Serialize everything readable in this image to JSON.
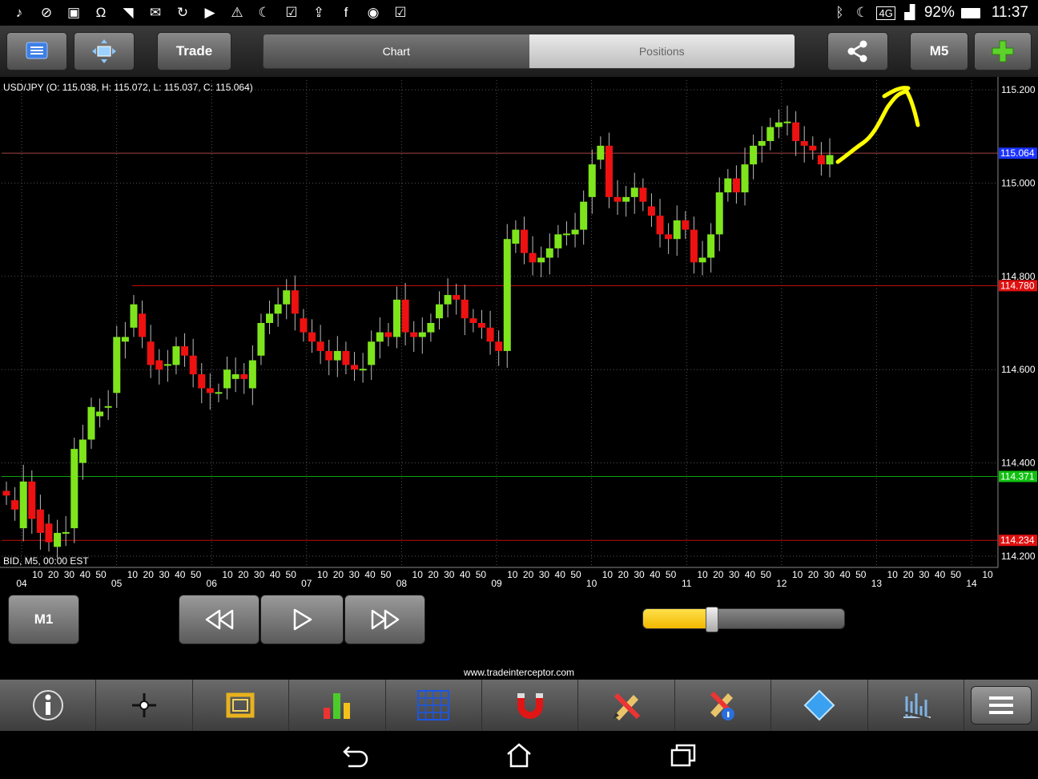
{
  "status": {
    "battery": "92%",
    "time": "11:37",
    "network": "4G"
  },
  "toolbar": {
    "trade_label": "Trade",
    "tabs": [
      "Chart",
      "Positions"
    ],
    "active_tab": "Chart",
    "timeframe_label": "M5"
  },
  "chart": {
    "header": "USD/JPY (O: 115.038, H: 115.072, L: 115.037, C: 115.064)",
    "footer": "BID, M5, 00:00 EST",
    "price_labels": [
      "115.200",
      "115.000",
      "114.800",
      "114.600",
      "114.400",
      "114.200"
    ],
    "markers": [
      {
        "label": "115.064",
        "color": "#1a33ff"
      },
      {
        "label": "114.780",
        "color": "#e01010"
      },
      {
        "label": "114.371",
        "color": "#10c010"
      },
      {
        "label": "114.234",
        "color": "#e01010"
      }
    ],
    "day_labels": [
      "04",
      "05",
      "06",
      "07",
      "08",
      "09",
      "10",
      "11",
      "12",
      "13",
      "14"
    ],
    "minute_labels": [
      "10",
      "20",
      "30",
      "40",
      "50"
    ],
    "colors": {
      "bull": "#7ee51c",
      "bear": "#ee1111",
      "annotation": "#ffff00"
    }
  },
  "chart_data": {
    "type": "candlestick",
    "symbol": "USD/JPY",
    "timeframe": "M5",
    "ylim": [
      114.18,
      115.22
    ],
    "current": {
      "open": 115.038,
      "high": 115.072,
      "low": 115.037,
      "close": 115.064
    },
    "horizontal_lines": [
      115.064,
      114.78,
      114.371,
      114.234
    ],
    "candles": [
      [
        114.34,
        114.33
      ],
      [
        114.32,
        114.3
      ],
      [
        114.26,
        114.36
      ],
      [
        114.36,
        114.28
      ],
      [
        114.3,
        114.25
      ],
      [
        114.27,
        114.23
      ],
      [
        114.22,
        114.25
      ],
      [
        114.25,
        114.25
      ],
      [
        114.26,
        114.43
      ],
      [
        114.4,
        114.45
      ],
      [
        114.45,
        114.52
      ],
      [
        114.5,
        114.51
      ],
      [
        114.52,
        114.52
      ],
      [
        114.55,
        114.67
      ],
      [
        114.66,
        114.67
      ],
      [
        114.69,
        114.74
      ],
      [
        114.72,
        114.67
      ],
      [
        114.66,
        114.61
      ],
      [
        114.62,
        114.6
      ],
      [
        114.61,
        114.61
      ],
      [
        114.61,
        114.65
      ],
      [
        114.65,
        114.63
      ],
      [
        114.63,
        114.59
      ],
      [
        114.59,
        114.56
      ],
      [
        114.56,
        114.55
      ],
      [
        114.55,
        114.55
      ],
      [
        114.56,
        114.6
      ],
      [
        114.58,
        114.59
      ],
      [
        114.59,
        114.58
      ],
      [
        114.56,
        114.62
      ],
      [
        114.63,
        114.7
      ],
      [
        114.7,
        114.72
      ],
      [
        114.72,
        114.74
      ],
      [
        114.74,
        114.77
      ],
      [
        114.77,
        114.72
      ],
      [
        114.71,
        114.68
      ],
      [
        114.68,
        114.66
      ],
      [
        114.66,
        114.64
      ],
      [
        114.64,
        114.62
      ],
      [
        114.62,
        114.64
      ],
      [
        114.64,
        114.61
      ],
      [
        114.61,
        114.6
      ],
      [
        114.6,
        114.6
      ],
      [
        114.61,
        114.66
      ],
      [
        114.66,
        114.68
      ],
      [
        114.68,
        114.67
      ],
      [
        114.67,
        114.75
      ],
      [
        114.75,
        114.68
      ],
      [
        114.68,
        114.67
      ],
      [
        114.67,
        114.68
      ],
      [
        114.68,
        114.7
      ],
      [
        114.71,
        114.74
      ],
      [
        114.74,
        114.76
      ],
      [
        114.76,
        114.75
      ],
      [
        114.75,
        114.71
      ],
      [
        114.71,
        114.7
      ],
      [
        114.7,
        114.69
      ],
      [
        114.69,
        114.66
      ],
      [
        114.66,
        114.64
      ],
      [
        114.64,
        114.88
      ],
      [
        114.87,
        114.9
      ],
      [
        114.9,
        114.85
      ],
      [
        114.85,
        114.83
      ],
      [
        114.83,
        114.84
      ],
      [
        114.84,
        114.86
      ],
      [
        114.86,
        114.89
      ],
      [
        114.89,
        114.89
      ],
      [
        114.89,
        114.9
      ],
      [
        114.9,
        114.96
      ],
      [
        114.97,
        115.04
      ],
      [
        115.05,
        115.08
      ],
      [
        115.08,
        114.97
      ],
      [
        114.97,
        114.96
      ],
      [
        114.96,
        114.97
      ],
      [
        114.97,
        114.99
      ],
      [
        114.99,
        114.96
      ],
      [
        114.95,
        114.93
      ],
      [
        114.93,
        114.89
      ],
      [
        114.89,
        114.88
      ],
      [
        114.88,
        114.92
      ],
      [
        114.92,
        114.9
      ],
      [
        114.9,
        114.83
      ],
      [
        114.83,
        114.84
      ],
      [
        114.84,
        114.89
      ],
      [
        114.89,
        114.98
      ],
      [
        114.98,
        115.01
      ],
      [
        115.01,
        114.98
      ],
      [
        114.98,
        115.04
      ],
      [
        115.04,
        115.08
      ],
      [
        115.08,
        115.09
      ],
      [
        115.09,
        115.12
      ],
      [
        115.12,
        115.13
      ],
      [
        115.13,
        115.13
      ],
      [
        115.13,
        115.09
      ],
      [
        115.09,
        115.08
      ],
      [
        115.08,
        115.07
      ],
      [
        115.06,
        115.04
      ],
      [
        115.04,
        115.06
      ]
    ]
  },
  "playback": {
    "timeframe_label": "M1",
    "speed_value": 0.34
  },
  "footer": {
    "url": "www.tradeinterceptor.com"
  },
  "bottom_tools": [
    "info-icon",
    "crosshair-icon",
    "zoom-frame-icon",
    "indicators-icon",
    "grid-icon",
    "magnet-icon",
    "draw-tools-icon",
    "draw-info-icon",
    "shapes-icon",
    "analysis-icon"
  ]
}
